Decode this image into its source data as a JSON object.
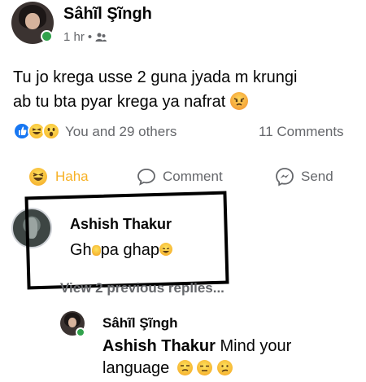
{
  "post": {
    "author": "Sâhĩl Şĩngh",
    "time": "1 hr",
    "separator": "•",
    "text_line1": "Tu jo krega usse 2 guna jyada m krungi",
    "text_line2": "ab tu bta pyar krega ya nafrat"
  },
  "reactions": {
    "summary": "You and 29 others",
    "comments_count": "11 Comments"
  },
  "actions": {
    "haha_label": "Haha",
    "comment_label": "Comment",
    "send_label": "Send"
  },
  "comment": {
    "author": "Ashish Thakur",
    "text_part1": "Gh",
    "text_part2": "pa ghap"
  },
  "view_replies": "View 2 previous replies...",
  "reply": {
    "author": "Sâhĩl Şĩngh",
    "tagged": "Ashish Thakur",
    "text_part1": " Mind your",
    "text_part2": "language"
  },
  "colors": {
    "haha_active": "#f7b125",
    "secondary_text": "#65676b",
    "online": "#31a24c",
    "like_blue": "#1877f2"
  }
}
